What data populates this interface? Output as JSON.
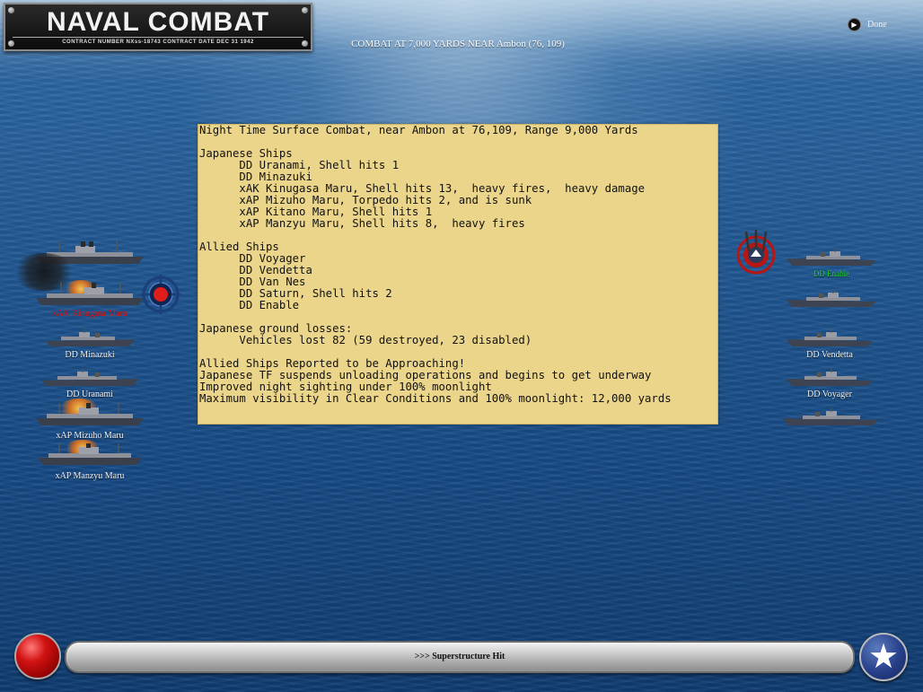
{
  "header": {
    "logo_title": "NAVAL COMBAT",
    "logo_subtitle": "CONTRACT NUMBER  NXss-18743        CONTRACT DATE  DEC 31  1942",
    "combat_title": "COMBAT AT 7,000 YARDS NEAR Ambon (76, 109)",
    "done_label": "Done"
  },
  "report": {
    "lines": [
      "Night Time Surface Combat, near Ambon at 76,109, Range 9,000 Yards",
      "",
      "Japanese Ships",
      "      DD Uranami, Shell hits 1",
      "      DD Minazuki",
      "      xAK Kinugasa Maru, Shell hits 13,  heavy fires,  heavy damage",
      "      xAP Mizuho Maru, Torpedo hits 2, and is sunk",
      "      xAP Kitano Maru, Shell hits 1",
      "      xAP Manzyu Maru, Shell hits 8,  heavy fires",
      "",
      "Allied Ships",
      "      DD Voyager",
      "      DD Vendetta",
      "      DD Van Nes",
      "      DD Saturn, Shell hits 2",
      "      DD Enable",
      "",
      "Japanese ground losses:",
      "      Vehicles lost 82 (59 destroyed, 23 disabled)",
      "",
      "Allied Ships Reported to be Approaching!",
      "Japanese TF suspends unloading operations and begins to get underway",
      "Improved night sighting under 100% moonlight",
      "Maximum visibility in Clear Conditions and 100% moonlight: 12,000 yards"
    ]
  },
  "japanese_ships": [
    {
      "label": ""
    },
    {
      "label": "xAK Kinugasa Maru"
    },
    {
      "label": "DD Minazuki"
    },
    {
      "label": "DD Uranami"
    },
    {
      "label": "xAP Mizuho Maru"
    },
    {
      "label": "xAP Manzyu Maru"
    }
  ],
  "allied_ships": [
    {
      "label": "DD Enable"
    },
    {
      "label": ""
    },
    {
      "label": "DD Vendetta"
    },
    {
      "label": "DD Voyager"
    },
    {
      "label": ""
    }
  ],
  "status_bar": {
    "text": ">>> Superstructure Hit"
  },
  "colors": {
    "report_bg": "#ebd58a",
    "target_label": "#e01818",
    "firing_label": "#20e020"
  }
}
